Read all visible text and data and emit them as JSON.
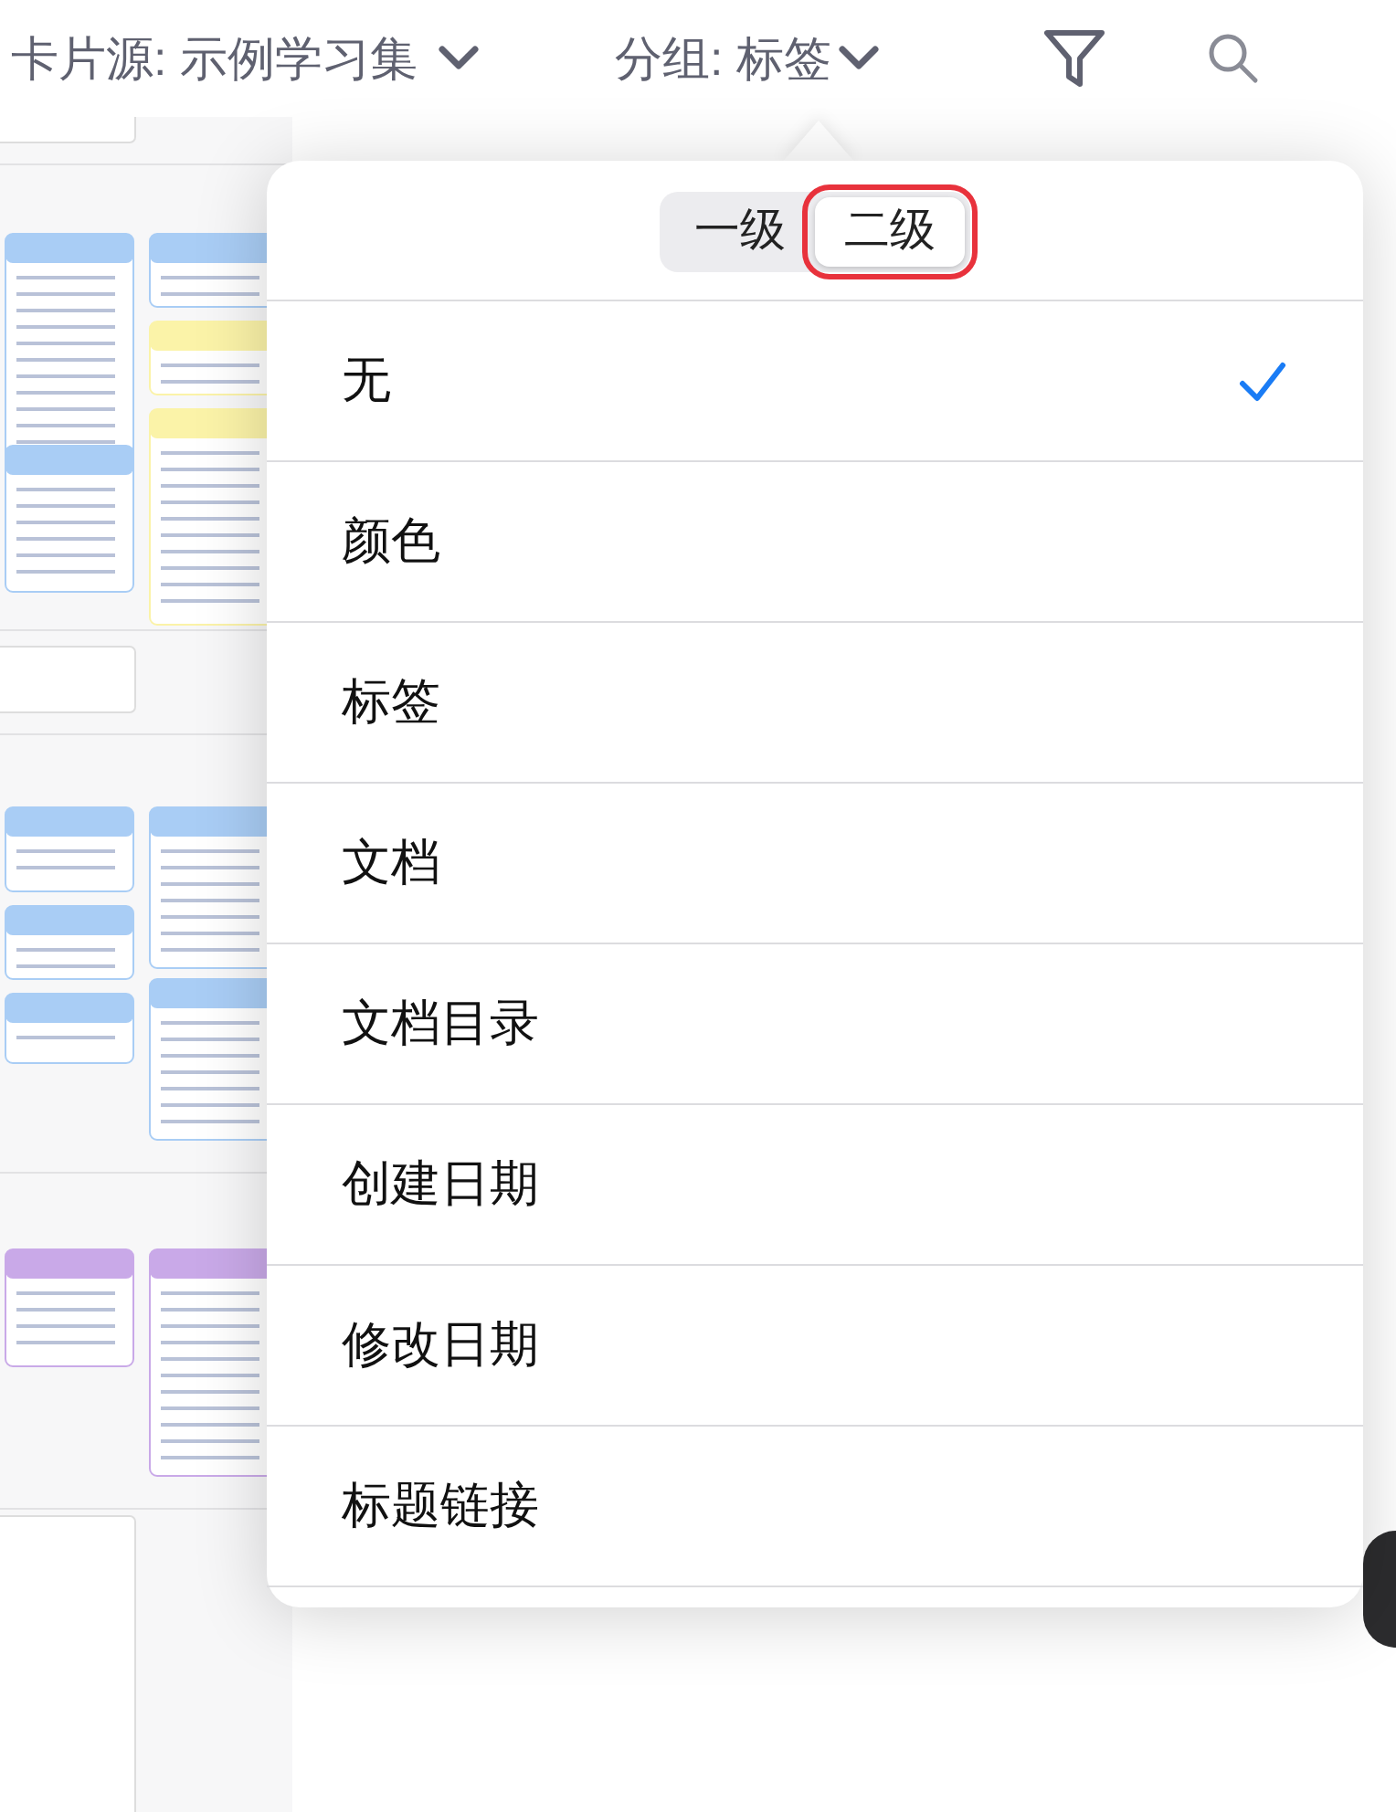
{
  "toolbar": {
    "source": {
      "label": "卡片源: 示例学习集"
    },
    "grouping": {
      "label": "分组: 标签"
    }
  },
  "popover": {
    "levels": [
      {
        "label": "一级",
        "selected": false,
        "highlighted": false
      },
      {
        "label": "二级",
        "selected": true,
        "highlighted": true
      }
    ],
    "options": [
      {
        "label": "无",
        "checked": true
      },
      {
        "label": "颜色",
        "checked": false
      },
      {
        "label": "标签",
        "checked": false
      },
      {
        "label": "文档",
        "checked": false
      },
      {
        "label": "文档目录",
        "checked": false
      },
      {
        "label": "创建日期",
        "checked": false
      },
      {
        "label": "修改日期",
        "checked": false
      },
      {
        "label": "标题链接",
        "checked": false
      }
    ]
  }
}
